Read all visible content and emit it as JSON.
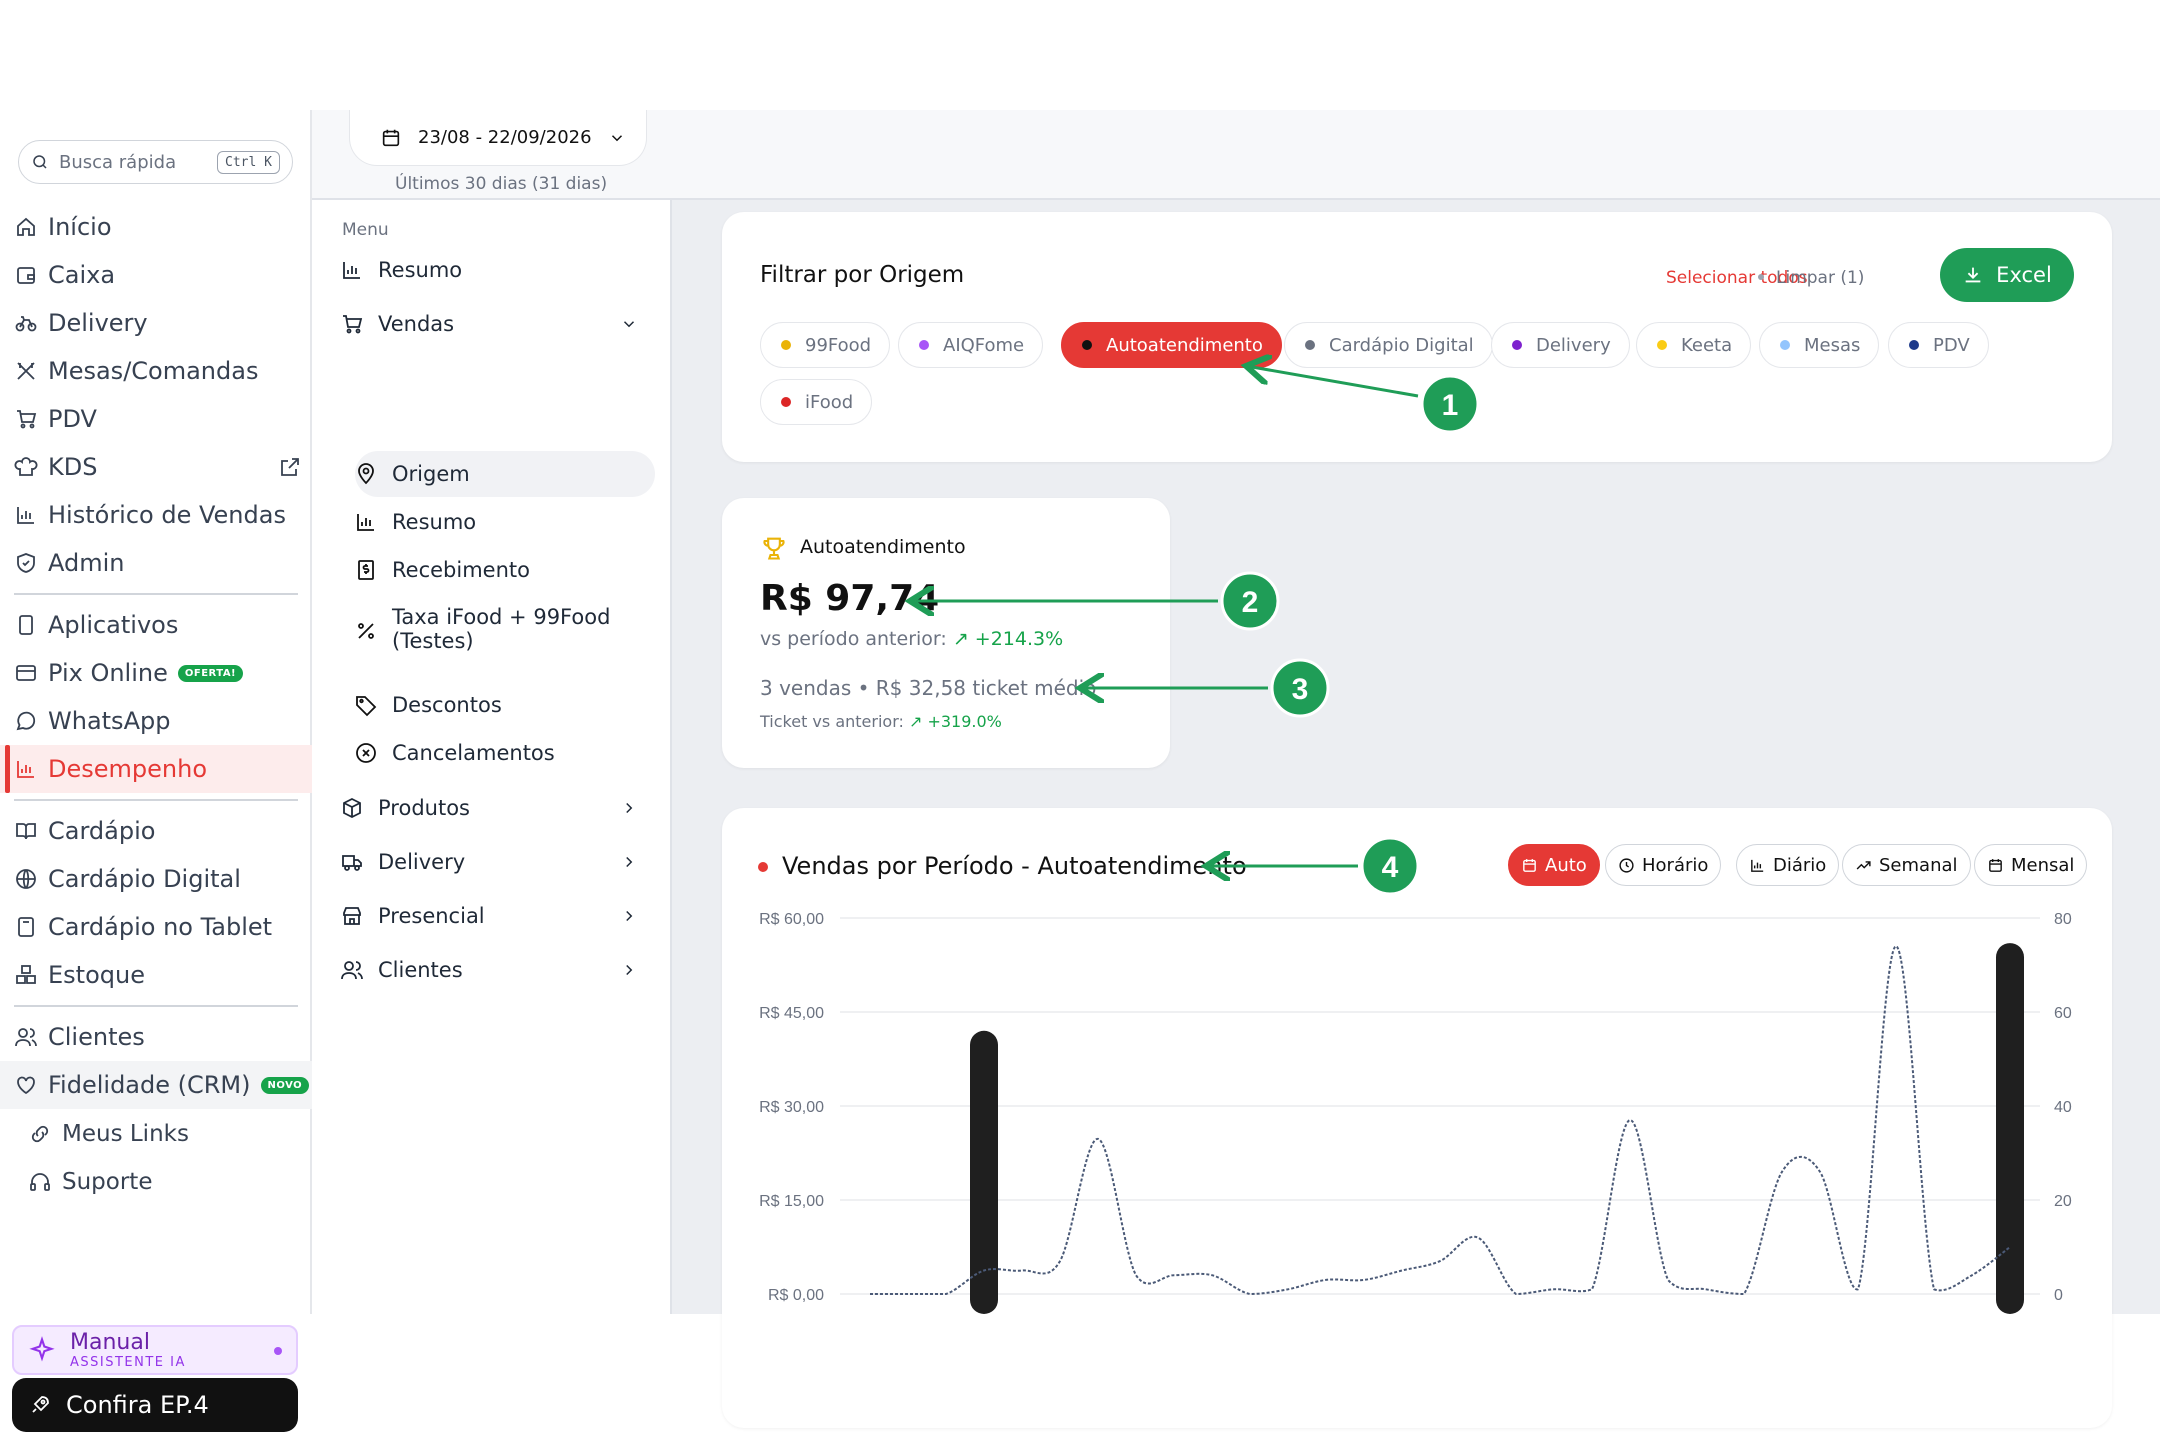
{
  "sidebar": {
    "search": {
      "placeholder": "Busca rápida",
      "shortcut": "Ctrl K"
    },
    "items": [
      {
        "label": "Início",
        "icon": "home-icon"
      },
      {
        "label": "Caixa",
        "icon": "cash-register-icon"
      },
      {
        "label": "Delivery",
        "icon": "bike-icon"
      },
      {
        "label": "Mesas/Comandas",
        "icon": "utensils-icon"
      },
      {
        "label": "PDV",
        "icon": "cart-icon"
      },
      {
        "label": "KDS",
        "icon": "chef-hat-icon"
      },
      {
        "label": "Histórico de Vendas",
        "icon": "bar-chart-icon"
      },
      {
        "label": "Admin",
        "icon": "shield-icon"
      }
    ],
    "items2": [
      {
        "label": "Aplicativos",
        "icon": "phone-icon"
      },
      {
        "label": "Pix Online",
        "icon": "card-icon",
        "badge": "OFERTA!"
      },
      {
        "label": "WhatsApp",
        "icon": "chat-icon"
      },
      {
        "label": "Desempenho",
        "icon": "bar-chart-icon",
        "active": true
      }
    ],
    "items3": [
      {
        "label": "Cardápio",
        "icon": "book-icon"
      },
      {
        "label": "Cardápio Digital",
        "icon": "globe-icon"
      },
      {
        "label": "Cardápio no Tablet",
        "icon": "tablet-icon"
      },
      {
        "label": "Estoque",
        "icon": "boxes-icon"
      }
    ],
    "items4": [
      {
        "label": "Clientes",
        "icon": "users-icon"
      },
      {
        "label": "Fidelidade (CRM)",
        "icon": "heart-icon",
        "badge": "NOVO"
      }
    ],
    "bottom": [
      {
        "label": "Meus Links",
        "icon": "link-icon"
      },
      {
        "label": "Suporte",
        "icon": "headset-icon"
      }
    ],
    "manual": {
      "title": "Manual",
      "subtitle": "ASSISTENTE IA"
    },
    "confira": "Confira EP.4"
  },
  "datebar": {
    "range": "23/08 - 22/09/2026",
    "caption": "Últimos 30 dias (31 dias)"
  },
  "submenu": {
    "heading": "Menu",
    "resumo": "Resumo",
    "vendas": "Vendas",
    "vendas_children": [
      "Origem",
      "Resumo",
      "Recebimento",
      "Taxa iFood + 99Food",
      "(Testes)",
      "Descontos",
      "Cancelamentos"
    ],
    "produtos": "Produtos",
    "delivery": "Delivery",
    "presencial": "Presencial",
    "clientes": "Clientes"
  },
  "filter": {
    "title": "Filtrar por Origem",
    "select_all": "Selecionar todos",
    "clear": "Limpar (1)",
    "excel": "Excel",
    "chips": [
      {
        "label": "99Food",
        "color": "#eab308",
        "selected": false
      },
      {
        "label": "AIQFome",
        "color": "#a855f7",
        "selected": false
      },
      {
        "label": "Autoatendimento",
        "color": "#111111",
        "selected": true
      },
      {
        "label": "Cardápio Digital",
        "color": "#6b7280",
        "selected": false
      },
      {
        "label": "Delivery",
        "color": "#7e22ce",
        "selected": false
      },
      {
        "label": "Keeta",
        "color": "#facc15",
        "selected": false
      },
      {
        "label": "Mesas",
        "color": "#93c5fd",
        "selected": false
      },
      {
        "label": "PDV",
        "color": "#1e3a8a",
        "selected": false
      },
      {
        "label": "iFood",
        "color": "#dc2626",
        "selected": false
      }
    ]
  },
  "kpi": {
    "title": "Autoatendimento",
    "value": "R$ 97,74",
    "vs_label": "vs período anterior:",
    "vs_value": "↗ +214.3%",
    "sales": "3 vendas • R$ 32,58 ticket médio",
    "ticket_label": "Ticket vs anterior:",
    "ticket_value": "↗ +319.0%"
  },
  "chart_card": {
    "title": "Vendas por Período - Autoatendimento",
    "periods": [
      {
        "label": "Auto",
        "icon": "calendar-icon",
        "selected": true
      },
      {
        "label": "Horário",
        "icon": "clock-icon",
        "selected": false
      },
      {
        "label": "Diário",
        "icon": "bar-chart-icon",
        "selected": false
      },
      {
        "label": "Semanal",
        "icon": "trend-icon",
        "selected": false
      },
      {
        "label": "Mensal",
        "icon": "calendar-icon",
        "selected": false
      }
    ]
  },
  "annotations": [
    "1",
    "2",
    "3",
    "4"
  ],
  "chart_data": {
    "type": "bar",
    "left_ticks": [
      "R$ 60,00",
      "R$ 45,00",
      "R$ 30,00",
      "R$ 15,00",
      "R$ 0,00"
    ],
    "right_ticks": [
      "80",
      "60",
      "40",
      "20",
      "0"
    ],
    "ylim_left": [
      0,
      60
    ],
    "ylim_right": [
      0,
      80
    ],
    "grid": true,
    "x": [
      0,
      1,
      2,
      3,
      4,
      5,
      6,
      7,
      8,
      9,
      10,
      11,
      12,
      13,
      14,
      15,
      16,
      17,
      18,
      19,
      20,
      21,
      22,
      23,
      24,
      25,
      26,
      27,
      28,
      29,
      30
    ],
    "series": [
      {
        "kind": "bar",
        "axis": "left",
        "color": "#1f1f1f",
        "values": [
          0,
          0,
          0,
          42,
          0,
          0,
          0,
          0,
          0,
          0,
          0,
          0,
          0,
          0,
          0,
          0,
          0,
          0,
          0,
          0,
          0,
          0,
          0,
          0,
          0,
          0,
          0,
          0,
          0,
          0,
          56
        ]
      },
      {
        "kind": "line",
        "axis": "right",
        "color": "#4b5a77",
        "dashed": true,
        "values": [
          0,
          0,
          0,
          5,
          5,
          7,
          33,
          4,
          4,
          4,
          0,
          1,
          3,
          3,
          5,
          7,
          12,
          0,
          1,
          1,
          37,
          3,
          1,
          0,
          26,
          26,
          1,
          74,
          1,
          4,
          10
        ]
      }
    ]
  }
}
